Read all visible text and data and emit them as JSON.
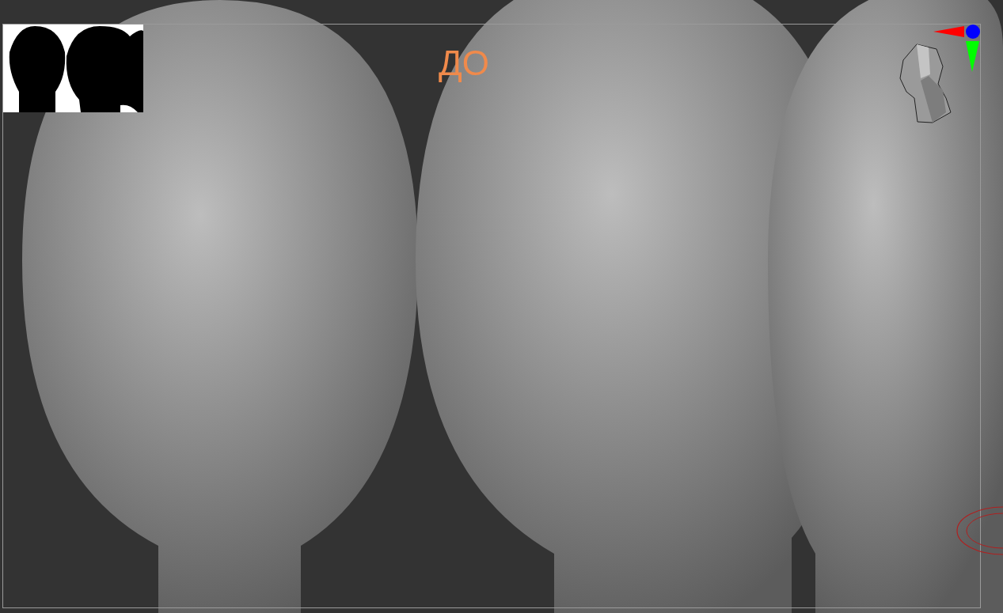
{
  "caption": "ДО"
}
